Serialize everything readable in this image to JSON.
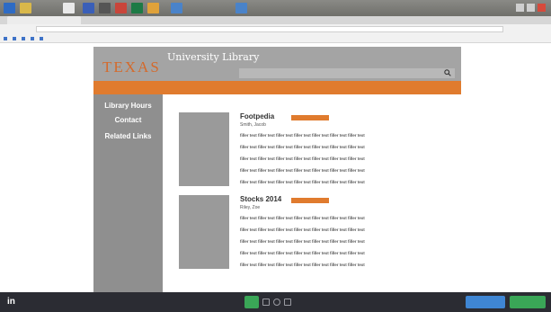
{
  "colors": {
    "accent_orange": "#e07b2e",
    "header_gray": "#a4a4a4",
    "sidebar_gray": "#8f8f8f",
    "thumbnail_gray": "#9a9a9a",
    "bottombar_dark": "#2b2c33",
    "primary_blue": "#3f86d4",
    "success_green": "#3aa657"
  },
  "browser": {
    "tab_title": "",
    "url": ""
  },
  "header": {
    "logo_text": "TEXAS",
    "title": "University Library",
    "search_icon": "search-icon"
  },
  "nav": {
    "items": [
      {
        "label": ""
      },
      {
        "label": ""
      },
      {
        "label": ""
      },
      {
        "label": ""
      }
    ]
  },
  "sidebar": {
    "library_hours": {
      "heading": "Library Hours",
      "lines": [
        "",
        "",
        ""
      ]
    },
    "contact": {
      "heading": "Contact",
      "lines": [
        "",
        ""
      ]
    },
    "related_links": {
      "heading": "Related Links",
      "lines": [
        "",
        "",
        "",
        ""
      ]
    }
  },
  "results": [
    {
      "title": "Footpedia",
      "badge": "",
      "author": "Smith, Jacob",
      "lines": [
        "filler text filler text filler text filler text filler text filler text filler text",
        "filler text filler text filler text filler text filler text filler text filler text",
        "filler text filler text filler text filler text filler text filler text filler text",
        "filler text filler text filler text filler text filler text filler text filler text",
        "filler text filler text filler text filler text filler text filler text filler text"
      ]
    },
    {
      "title": "Stocks 2014",
      "badge": "",
      "author": "Riley, Zoe",
      "lines": [
        "filler text filler text filler text filler text filler text filler text filler text",
        "filler text filler text filler text filler text filler text filler text filler text",
        "filler text filler text filler text filler text filler text filler text filler text",
        "filler text filler text filler text filler text filler text filler text filler text",
        "filler text filler text filler text filler text filler text filler text filler text"
      ]
    }
  ],
  "bottombar": {
    "logo": "in",
    "links": [
      "",
      ""
    ],
    "primary_button": "",
    "success_button": ""
  }
}
